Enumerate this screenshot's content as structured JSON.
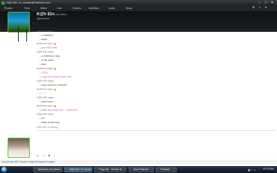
{
  "window": {
    "title": "K@h $1n <h_kindah@hotmail.com>"
  },
  "menu": [
    {
      "label": "Photos"
    },
    {
      "label": "Files"
    },
    {
      "label": "Video"
    },
    {
      "label": "Call"
    },
    {
      "label": "Games"
    },
    {
      "label": "Activities"
    },
    {
      "label": "Invite"
    },
    {
      "label": "Block"
    }
  ],
  "contact": {
    "name": "K@h $1n",
    "name_suffix": "(Available)",
    "status": "@yourname"
  },
  "conversation": [
    {
      "type": "sender",
      "text": "Kah Sin says:"
    },
    {
      "type": "msg",
      "text": "u sickliao?"
    },
    {
      "type": "msg",
      "text": "kaha"
    },
    {
      "type": "sender",
      "text": "aedhena says:",
      "emoticon": true
    },
    {
      "type": "msg",
      "text": "you 200 freak",
      "pink": true
    },
    {
      "type": "sender",
      "text": "K@h $1n says:"
    },
    {
      "type": "msg",
      "text": "u nothing to say"
    },
    {
      "type": "msg",
      "text": "in de soon"
    },
    {
      "type": "msg",
      "text": "frac"
    },
    {
      "type": "sender",
      "text": "aedhena says:",
      "emoticon": true
    },
    {
      "type": "msg",
      "text": "11111",
      "pink": true
    },
    {
      "type": "msg",
      "text": "u got alot thing to say meh",
      "pink": true
    },
    {
      "type": "sender",
      "text": "K@h $1n says:"
    },
    {
      "type": "msg",
      "text": "how cold fox u freeze?"
    },
    {
      "type": "sender",
      "text": "aedhena says:",
      "emoticon": true
    },
    {
      "type": "msg",
      "text": "* ^ *",
      "pink": true
    },
    {
      "type": "sender",
      "text": "K@h $1n says:"
    },
    {
      "type": "msg",
      "text": "dont cry hi"
    },
    {
      "type": "sender",
      "text": "aedhena says:",
      "emoticon": true
    },
    {
      "type": "msg",
      "text": "thats so young hoe.. u killed us?",
      "pink": true
    },
    {
      "type": "sender",
      "text": "K@h $1n says:"
    },
    {
      "type": "msg",
      "text": "ok"
    },
    {
      "type": "msg",
      "text": "have a rest now"
    }
  ],
  "typing": "K@h $1n is writing...",
  "toolbar": {
    "font": "A",
    "emoticons": "☺",
    "wink": "☻",
    "nudge": "♪"
  },
  "statusbar": {
    "text": "Sucit Entire 5SP Bookes+Objects Explorer Toolbar"
  },
  "taskbar": {
    "items": [
      {
        "label": "Windows Live Mess..."
      },
      {
        "label": "K@h $1n <h_kinda..."
      },
      {
        "label": "'Fag Mal' - Mozilla fir..."
      },
      {
        "label": "Shart Patcher"
      },
      {
        "label": "Pictures"
      }
    ],
    "clock": "10:23 AM"
  }
}
